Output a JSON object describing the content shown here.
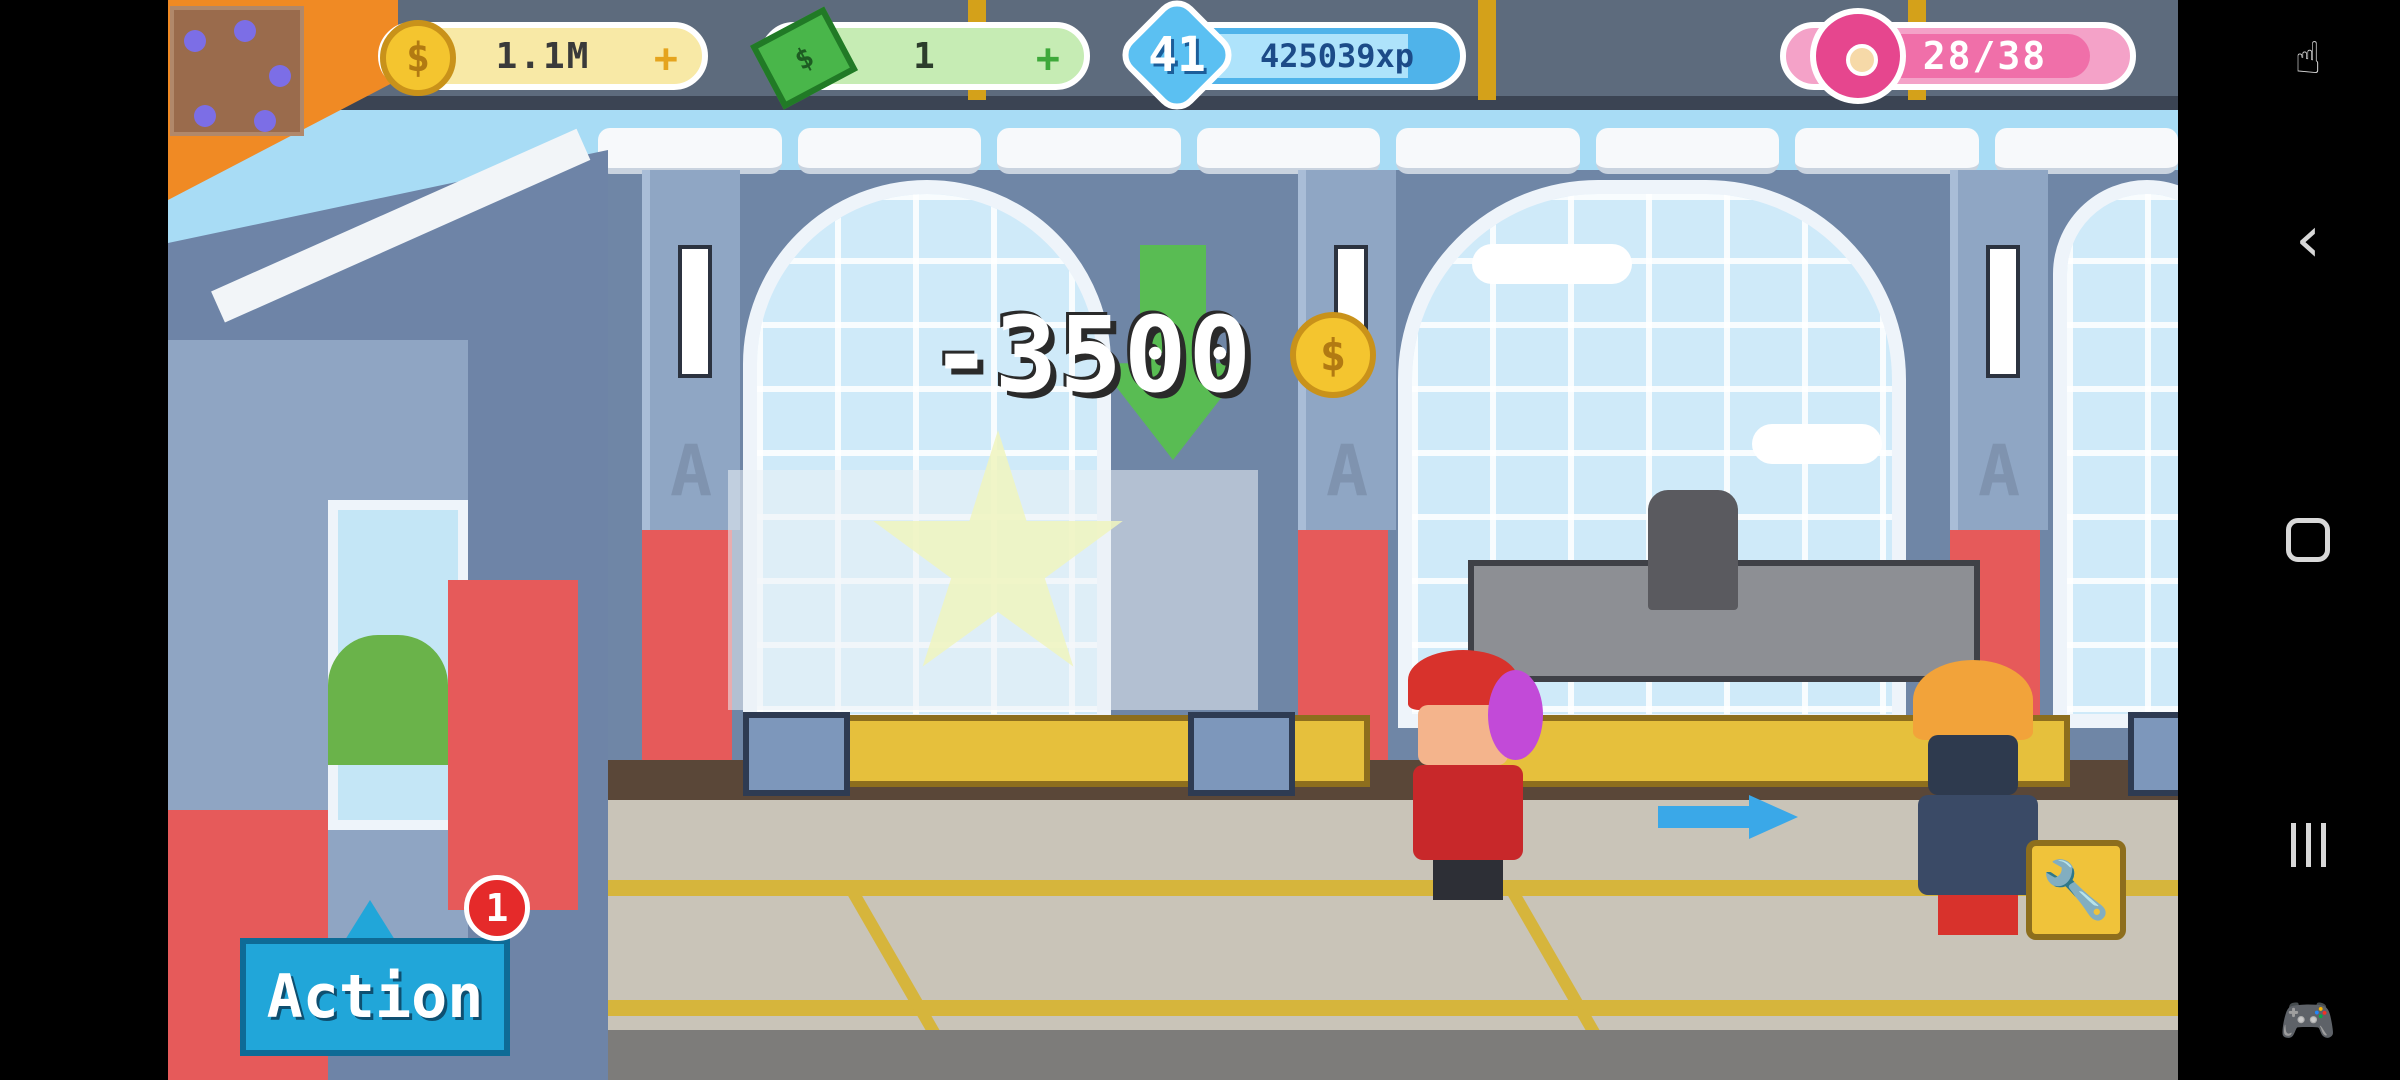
{
  "hud": {
    "coins": {
      "value": "1.1M",
      "plus": "+"
    },
    "cash": {
      "value": "1",
      "plus": "+"
    },
    "level": {
      "number": "41",
      "xp": "425039xp"
    },
    "donuts": {
      "value": "28/38"
    }
  },
  "popup": {
    "cost": "-3500"
  },
  "actions": {
    "action_label": "Action",
    "notification_count": "1"
  },
  "icons": {
    "coin": "coin-icon",
    "cash": "cash-icon",
    "level": "level-badge-icon",
    "donut": "donut-icon",
    "wrench": "wrench-icon",
    "nav_back": "back-icon",
    "nav_home": "home-icon",
    "nav_recents": "recents-icon",
    "nav_game": "gamepad-icon",
    "nav_touch": "touch-lock-icon"
  },
  "colors": {
    "coin": "#f4c52f",
    "cash": "#49b64a",
    "xp": "#4fb3ea",
    "donut": "#e6468e",
    "action": "#21a6d9",
    "badge": "#e52a2a"
  }
}
